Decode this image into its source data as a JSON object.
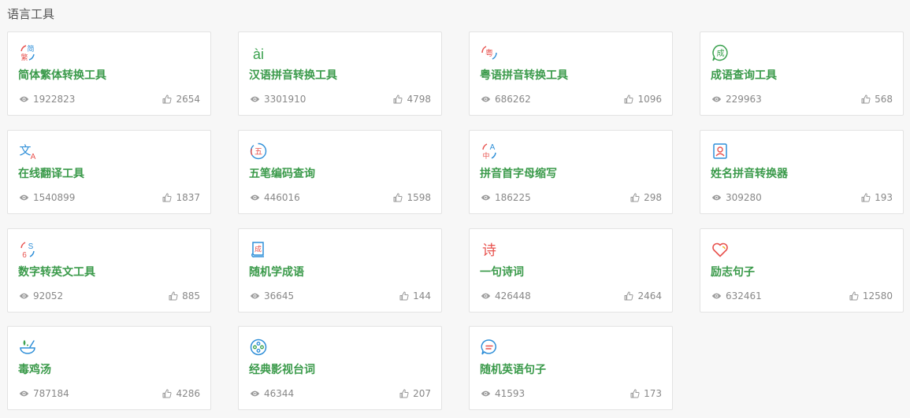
{
  "section_title": "语言工具",
  "tools": [
    {
      "name": "简体繁体转换工具",
      "views": "1922823",
      "likes": "2654",
      "icon": "simplified-traditional-icon"
    },
    {
      "name": "汉语拼音转换工具",
      "views": "3301910",
      "likes": "4798",
      "icon": "pinyin-ai-icon"
    },
    {
      "name": "粤语拼音转换工具",
      "views": "686262",
      "likes": "1096",
      "icon": "cantonese-icon"
    },
    {
      "name": "成语查询工具",
      "views": "229963",
      "likes": "568",
      "icon": "idiom-bubble-icon"
    },
    {
      "name": "在线翻译工具",
      "views": "1540899",
      "likes": "1837",
      "icon": "translate-icon"
    },
    {
      "name": "五笔编码查询",
      "views": "446016",
      "likes": "1598",
      "icon": "wubi-icon"
    },
    {
      "name": "拼音首字母缩写",
      "views": "186225",
      "likes": "298",
      "icon": "initials-icon"
    },
    {
      "name": "姓名拼音转换器",
      "views": "309280",
      "likes": "193",
      "icon": "name-card-icon"
    },
    {
      "name": "数字转英文工具",
      "views": "92052",
      "likes": "885",
      "icon": "number-english-icon"
    },
    {
      "name": "随机学成语",
      "views": "36645",
      "likes": "144",
      "icon": "idiom-book-icon"
    },
    {
      "name": "一句诗词",
      "views": "426448",
      "likes": "2464",
      "icon": "poem-icon"
    },
    {
      "name": "励志句子",
      "views": "632461",
      "likes": "12580",
      "icon": "heart-icon"
    },
    {
      "name": "毒鸡汤",
      "views": "787184",
      "likes": "4286",
      "icon": "soup-bowl-icon"
    },
    {
      "name": "经典影视台词",
      "views": "46344",
      "likes": "207",
      "icon": "film-reel-icon"
    },
    {
      "name": "随机英语句子",
      "views": "41593",
      "likes": "173",
      "icon": "chat-bubble-icon"
    }
  ],
  "icon_glyphs": {
    "simplified": "简",
    "traditional": "繁",
    "pinyin": "ài",
    "cantonese": "粤",
    "idiom": "成",
    "translate_zh": "文",
    "translate_en": "A",
    "wubi": "五",
    "initial_en": "A",
    "initial_zh": "中",
    "num_letter": "S",
    "num_digit": "6",
    "idiom_book": "成",
    "poem": "诗"
  },
  "colors": {
    "accent_green": "#3a9a4a",
    "icon_red": "#e8534f",
    "icon_blue": "#2f8fd8",
    "icon_green": "#3aa14e",
    "icon_yellow": "#f0b429"
  }
}
